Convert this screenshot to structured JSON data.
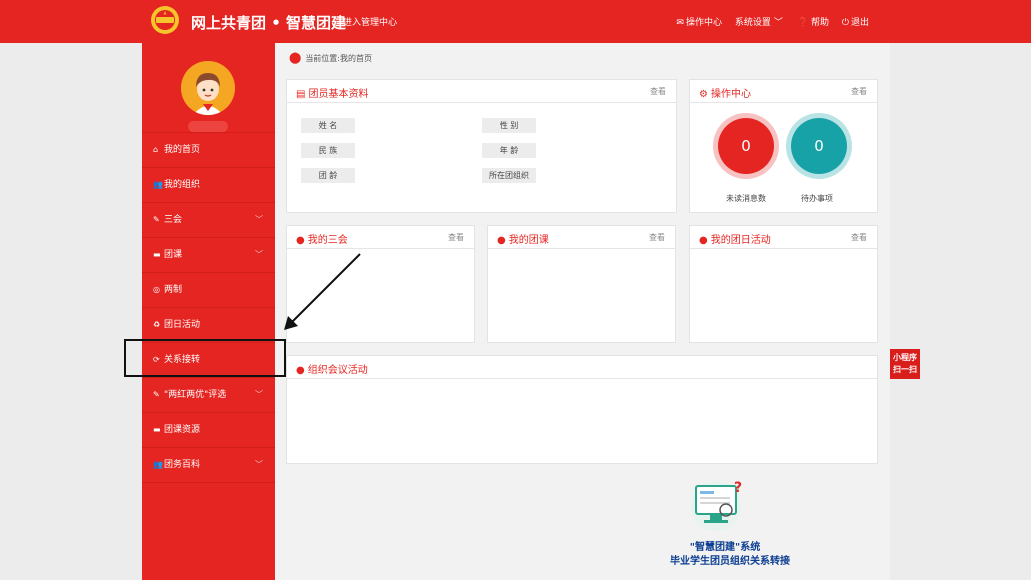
{
  "header": {
    "brand": "网上共青团 • 智慧团建",
    "admin_link": "进入管理中心",
    "nav": [
      {
        "label": "操作中心",
        "icon": "envelope-icon"
      },
      {
        "label": "系统设置",
        "icon": "chevron-down-icon"
      },
      {
        "label": "帮助",
        "icon": "question-icon"
      },
      {
        "label": "退出",
        "icon": "power-icon"
      }
    ]
  },
  "sidebar": {
    "menu": [
      {
        "label": "我的首页",
        "icon": "home-icon",
        "expandable": false
      },
      {
        "label": "我的组织",
        "icon": "users-icon",
        "expandable": false
      },
      {
        "label": "三会",
        "icon": "edit-icon",
        "expandable": true
      },
      {
        "label": "团课",
        "icon": "folder-icon",
        "expandable": true
      },
      {
        "label": "两制",
        "icon": "target-icon",
        "expandable": false
      },
      {
        "label": "团日活动",
        "icon": "recycle-icon",
        "expandable": false
      },
      {
        "label": "关系接转",
        "icon": "refresh-icon",
        "expandable": false
      },
      {
        "label": "\"两红两优\"评选",
        "icon": "edit-icon",
        "expandable": true
      },
      {
        "label": "团课资源",
        "icon": "folder-icon",
        "expandable": false
      },
      {
        "label": "团务百科",
        "icon": "users-icon",
        "expandable": true
      }
    ]
  },
  "breadcrumb": "当前位置:我的首页",
  "member_info": {
    "title": "团员基本资料",
    "more": "查看",
    "fields": [
      "姓 名",
      "性 别",
      "民 族",
      "年 龄",
      "团 龄",
      "所在团组织"
    ]
  },
  "ops_center": {
    "title": "操作中心",
    "more": "查看",
    "unread_count": "0",
    "unread_label": "未读消息数",
    "todo_count": "0",
    "todo_label": "待办事项"
  },
  "cards": {
    "sanhui": {
      "title": "我的三会",
      "more": "查看"
    },
    "tuanke": {
      "title": "我的团课",
      "more": "查看"
    },
    "tuanri": {
      "title": "我的团日活动",
      "more": "查看"
    },
    "meeting": {
      "title": "组织会议活动"
    }
  },
  "promo": {
    "line1": "\"智慧团建\"系统",
    "line2": "毕业学生团员组织关系转接"
  },
  "mini_program": {
    "line1": "小程序",
    "line2": "扫一扫"
  },
  "colors": {
    "brand_red": "#e52521",
    "unread_red": "#e52521",
    "todo_teal": "#17a2a8"
  }
}
